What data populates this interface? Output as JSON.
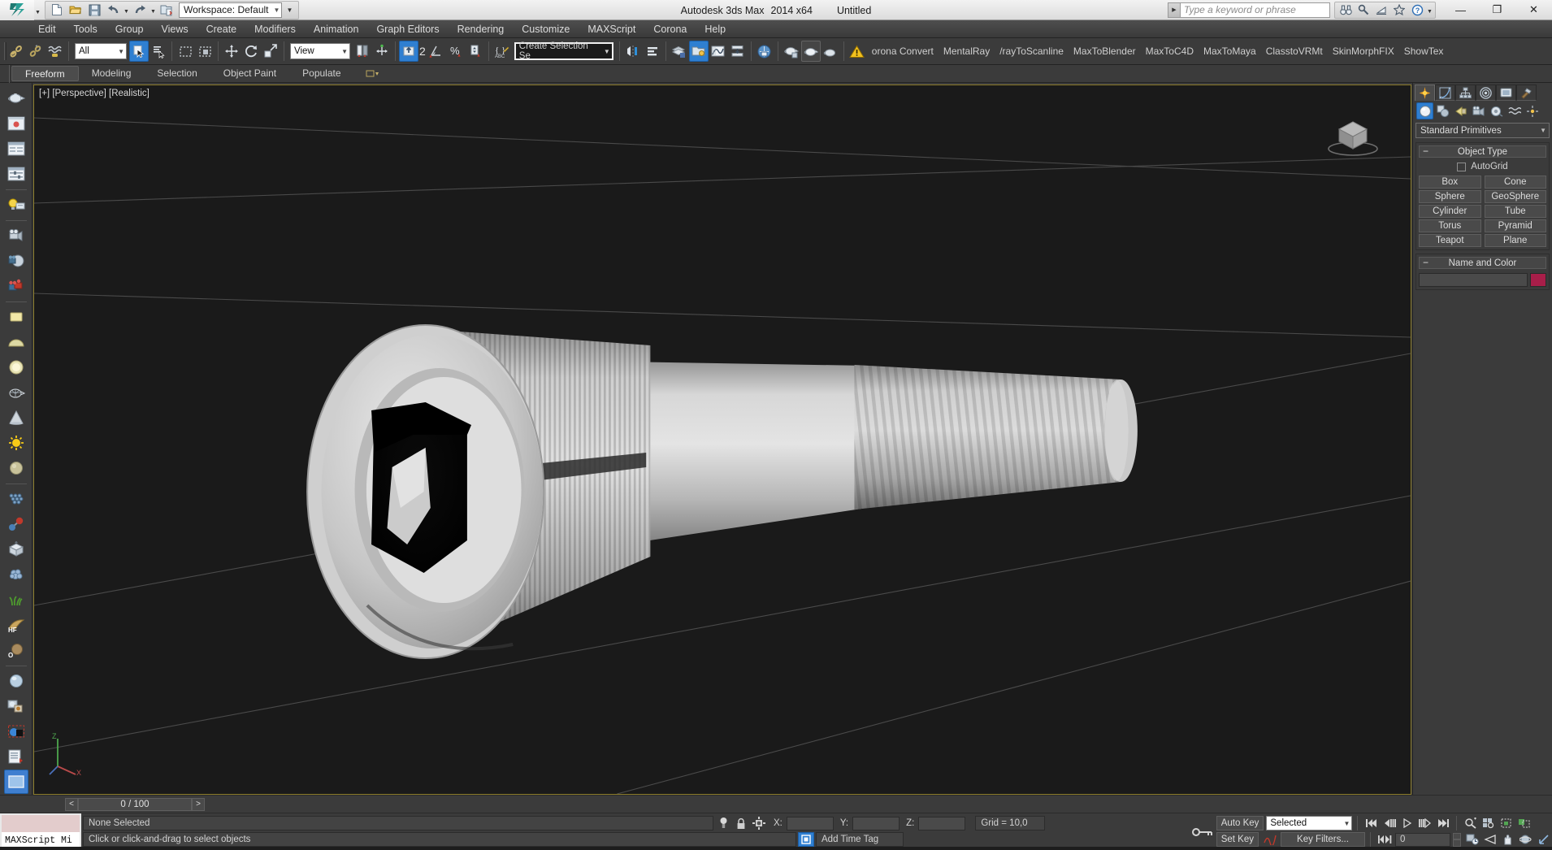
{
  "app": {
    "title_product": "Autodesk 3ds Max",
    "title_version": "2014 x64",
    "title_document": "Untitled",
    "logo_icon": "autodesk-3dsmax-logo"
  },
  "quick_access": {
    "items": [
      {
        "name": "new-file-button",
        "icon": "new-file-icon"
      },
      {
        "name": "open-file-button",
        "icon": "open-folder-icon"
      },
      {
        "name": "save-file-button",
        "icon": "floppy-save-icon"
      },
      {
        "name": "undo-button",
        "icon": "undo-arrow-icon"
      },
      {
        "name": "redo-button",
        "icon": "redo-arrow-icon"
      },
      {
        "name": "project-folder-button",
        "icon": "project-folder-icon"
      }
    ],
    "workspace_label": "Workspace: Default"
  },
  "search": {
    "placeholder": "Type a keyword or phrase",
    "value": ""
  },
  "help_group": [
    {
      "name": "search-binoculars-button",
      "icon": "binoculars-icon"
    },
    {
      "name": "keyword-search-button",
      "icon": "magnifier-key-icon"
    },
    {
      "name": "subscription-button",
      "icon": "satellite-dish-icon"
    },
    {
      "name": "favorites-button",
      "icon": "star-icon"
    },
    {
      "name": "help-button",
      "icon": "question-circle-icon"
    }
  ],
  "window_buttons": [
    {
      "name": "minimize-button",
      "glyph": "—"
    },
    {
      "name": "maximize-button",
      "glyph": "❐"
    },
    {
      "name": "close-button",
      "glyph": "✕"
    }
  ],
  "menu": {
    "items": [
      "Edit",
      "Tools",
      "Group",
      "Views",
      "Create",
      "Modifiers",
      "Animation",
      "Graph Editors",
      "Rendering",
      "Customize",
      "MAXScript",
      "Corona",
      "Help"
    ]
  },
  "main_toolbar": {
    "selection_filter": "All",
    "reference_coord": "View",
    "named_selection_set": "Create Selection Se",
    "buttons": [
      {
        "name": "select-and-link-button",
        "icon": "link-chain-icon"
      },
      {
        "name": "unlink-selection-button",
        "icon": "broken-link-icon"
      },
      {
        "name": "bind-to-space-warp-button",
        "icon": "space-warp-icon"
      },
      {
        "name": "select-object-button",
        "icon": "arrow-cursor-icon",
        "active": true
      },
      {
        "name": "select-by-name-button",
        "icon": "select-by-name-icon"
      },
      {
        "name": "rectangular-select-region-button",
        "icon": "rect-marquee-icon"
      },
      {
        "name": "window-crossing-button",
        "icon": "window-crossing-icon"
      },
      {
        "name": "select-and-move-button",
        "icon": "move-gizmo-icon"
      },
      {
        "name": "select-and-rotate-button",
        "icon": "rotate-gizmo-icon"
      },
      {
        "name": "select-and-scale-button",
        "icon": "scale-gizmo-icon"
      },
      {
        "name": "use-pivot-center-button",
        "icon": "pivot-center-icon"
      },
      {
        "name": "select-and-manipulate-button",
        "icon": "manipulate-icon"
      },
      {
        "name": "snaps-toggle-button",
        "icon": "snap-magnet-icon",
        "active": true
      },
      {
        "name": "angle-snap-toggle-button",
        "icon": "angle-snap-icon",
        "label": "2"
      },
      {
        "name": "percent-snap-toggle-button",
        "icon": "percent-snap-icon"
      },
      {
        "name": "spinner-snap-toggle-button",
        "icon": "spinner-snap-icon"
      },
      {
        "name": "edit-named-selection-sets-button",
        "icon": "named-set-edit-icon"
      },
      {
        "name": "mirror-button",
        "icon": "mirror-icon"
      },
      {
        "name": "align-button",
        "icon": "align-icon"
      },
      {
        "name": "layer-manager-button",
        "icon": "layers-icon"
      },
      {
        "name": "scene-explorer-button",
        "icon": "scene-explorer-icon",
        "active": true
      },
      {
        "name": "curve-editor-button",
        "icon": "curve-editor-icon"
      },
      {
        "name": "schematic-view-button",
        "icon": "schematic-view-icon"
      },
      {
        "name": "material-editor-button",
        "icon": "material-editor-icon"
      },
      {
        "name": "render-setup-button",
        "icon": "teapot-render-setup-icon"
      },
      {
        "name": "rendered-frame-window-button",
        "icon": "teapot-frame-icon"
      },
      {
        "name": "render-production-button",
        "icon": "teapot-render-icon"
      },
      {
        "name": "warning-button",
        "icon": "warning-triangle-icon"
      }
    ],
    "plugin_names": [
      "orona Convert",
      "MentalRay",
      "/rayToScanline",
      "MaxToBlender",
      "MaxToC4D",
      "MaxToMaya",
      "ClasstoVRMt",
      "SkinMorphFIX",
      "ShowTex"
    ]
  },
  "ribbon": {
    "tabs": [
      {
        "label": "Freeform",
        "active": true
      },
      {
        "label": "Modeling",
        "active": false
      },
      {
        "label": "Selection",
        "active": false
      },
      {
        "label": "Object Paint",
        "active": false
      },
      {
        "label": "Populate",
        "active": false
      }
    ],
    "overflow_icon": "ribbon-overflow-icon"
  },
  "left_toolbar": {
    "items": [
      {
        "name": "teapot-tool-button",
        "icon": "teapot-icon"
      },
      {
        "name": "render-preview-button",
        "icon": "render-preview-icon"
      },
      {
        "name": "list-panel-button",
        "icon": "list-panel-icon"
      },
      {
        "name": "slider-panel-button",
        "icon": "slider-panel-icon"
      },
      {
        "name": "light-lister-button",
        "icon": "lightbulb-icon"
      },
      {
        "name": "camera-tool-button",
        "icon": "camera-icon"
      },
      {
        "name": "camera-sphere-button",
        "icon": "camera-sphere-icon"
      },
      {
        "name": "stereo-camera-button",
        "icon": "stereo-camera-icon"
      },
      {
        "name": "plane-light-button",
        "icon": "plane-light-icon"
      },
      {
        "name": "dome-light-button",
        "icon": "dome-light-icon"
      },
      {
        "name": "sphere-light-button",
        "icon": "sphere-light-icon"
      },
      {
        "name": "teapot-wire-button",
        "icon": "wire-teapot-icon"
      },
      {
        "name": "cone-light-button",
        "icon": "cone-icon"
      },
      {
        "name": "sun-light-button",
        "icon": "sun-icon"
      },
      {
        "name": "sphere-object-button",
        "icon": "sphere-object-icon"
      },
      {
        "name": "grid-array-button",
        "icon": "grid-array-icon"
      },
      {
        "name": "particle-link-button",
        "icon": "molecule-icon"
      },
      {
        "name": "proxy-object-button",
        "icon": "proxy-box-icon"
      },
      {
        "name": "scatter-button",
        "icon": "scatter-cloud-icon"
      },
      {
        "name": "grass-button",
        "icon": "grass-icon"
      },
      {
        "name": "hair-fur-button",
        "icon": "hair-fur-icon"
      },
      {
        "name": "occlusion-button",
        "icon": "occlusion-icon"
      },
      {
        "name": "material-sphere-button",
        "icon": "material-sphere-icon"
      },
      {
        "name": "material-swap-button",
        "icon": "material-swap-icon"
      },
      {
        "name": "matte-object-button",
        "icon": "matte-object-icon"
      },
      {
        "name": "render-elements-button",
        "icon": "render-elements-icon"
      },
      {
        "name": "active-viewport-button",
        "icon": "active-viewport-icon",
        "active": true
      }
    ]
  },
  "viewport": {
    "label": "[+] [Perspective] [Realistic]",
    "label_parts": [
      "[+]",
      "[Perspective]",
      "[Realistic]"
    ],
    "border_color": "#8a7b2a",
    "background": "#1a1a1a",
    "grid_color": "#4e4e4e",
    "viewcube_icon": "view-cube-icon",
    "axis_gizmo": {
      "x": "X",
      "y": "Y",
      "z": "Z"
    },
    "model": "socket-head-cap-screw"
  },
  "command_panel": {
    "tabs": [
      {
        "name": "create-tab",
        "icon": "create-star-icon",
        "active": true
      },
      {
        "name": "modify-tab",
        "icon": "modify-curve-icon",
        "active": false
      },
      {
        "name": "hierarchy-tab",
        "icon": "hierarchy-icon",
        "active": false
      },
      {
        "name": "motion-tab",
        "icon": "motion-wheel-icon",
        "active": false
      },
      {
        "name": "display-tab",
        "icon": "display-monitor-icon",
        "active": false
      },
      {
        "name": "utilities-tab",
        "icon": "hammer-icon",
        "active": false
      }
    ],
    "category_buttons": [
      {
        "name": "geometry-category",
        "icon": "geometry-sphere-icon",
        "active": true
      },
      {
        "name": "shapes-category",
        "icon": "shapes-icon",
        "active": false
      },
      {
        "name": "lights-category",
        "icon": "light-icon",
        "active": false
      },
      {
        "name": "cameras-category",
        "icon": "camera-icon",
        "active": false
      },
      {
        "name": "helpers-category",
        "icon": "tape-measure-icon",
        "active": false
      },
      {
        "name": "space-warps-category",
        "icon": "space-warp-waves-icon",
        "active": false
      },
      {
        "name": "systems-category",
        "icon": "systems-icon",
        "active": false
      }
    ],
    "primitive_dropdown": "Standard Primitives",
    "object_type": {
      "header": "Object Type",
      "autogrid_label": "AutoGrid",
      "autogrid_checked": false,
      "buttons": [
        "Box",
        "Cone",
        "Sphere",
        "GeoSphere",
        "Cylinder",
        "Tube",
        "Torus",
        "Pyramid",
        "Teapot",
        "Plane"
      ]
    },
    "name_and_color": {
      "header": "Name and Color",
      "name_value": "",
      "color": "#a81e49"
    }
  },
  "time_slider": {
    "prev_label": "<",
    "next_label": ">",
    "frame_label": "0 / 100"
  },
  "status_bar": {
    "maxscript_label": "MAXScript Mi",
    "selection_status": "None Selected",
    "prompt": "Click or click-and-drag to select objects",
    "coords": {
      "x_label": "X:",
      "x_value": "",
      "y_label": "Y:",
      "y_value": "",
      "z_label": "Z:",
      "z_value": ""
    },
    "grid_label": "Grid = 10,0",
    "add_time_tag": "Add Time Tag",
    "icons": [
      {
        "name": "selection-lock-hint-icon",
        "icon": "bulb-icon"
      },
      {
        "name": "selection-lock-toggle",
        "icon": "padlock-icon"
      },
      {
        "name": "absolute-relative-toggle",
        "icon": "transform-mode-icon"
      },
      {
        "name": "time-tag-toggle",
        "icon": "time-tag-icon"
      },
      {
        "name": "key-mode-toggle",
        "icon": "key-icon"
      }
    ]
  },
  "animation_bar": {
    "auto_key_label": "Auto Key",
    "set_key_label": "Set Key",
    "key_filters_label": "Key Filters...",
    "selection_level": "Selected",
    "current_frame": "0",
    "playback_buttons": [
      {
        "name": "go-to-start-button",
        "icon": "skip-start-icon"
      },
      {
        "name": "previous-frame-button",
        "icon": "step-back-icon"
      },
      {
        "name": "play-animation-button",
        "icon": "play-icon"
      },
      {
        "name": "next-frame-button",
        "icon": "step-forward-icon"
      },
      {
        "name": "go-to-end-button",
        "icon": "skip-end-icon"
      },
      {
        "name": "key-mode-toggle-button",
        "icon": "key-mode-icon"
      }
    ],
    "nav_buttons": [
      {
        "name": "zoom-button",
        "icon": "zoom-magnifier-icon"
      },
      {
        "name": "zoom-all-button",
        "icon": "zoom-all-icon"
      },
      {
        "name": "zoom-extents-button",
        "icon": "zoom-extents-icon"
      },
      {
        "name": "zoom-region-button",
        "icon": "zoom-region-icon"
      },
      {
        "name": "field-of-view-button",
        "icon": "field-of-view-icon"
      },
      {
        "name": "pan-view-button",
        "icon": "pan-hand-icon"
      },
      {
        "name": "orbit-button",
        "icon": "orbit-icon"
      },
      {
        "name": "maximize-viewport-button",
        "icon": "maximize-viewport-icon"
      }
    ],
    "time_config_icon": "time-configuration-icon"
  }
}
